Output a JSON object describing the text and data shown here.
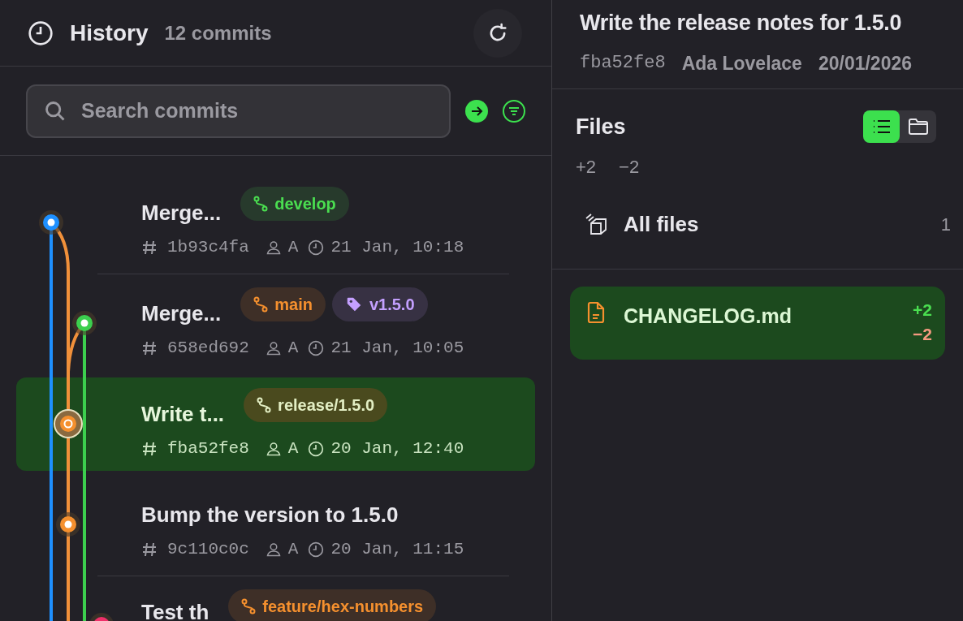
{
  "history": {
    "title": "History",
    "count": "12 commits"
  },
  "search": {
    "placeholder": "Search commits"
  },
  "commits": [
    {
      "title": "Merge...",
      "hash": "1b93c4fa",
      "author": "A",
      "time": "21 Jan, 10:18",
      "selected": false,
      "color": "#1e90ff",
      "refs": [
        {
          "kind": "branch",
          "label": "develop",
          "color": "#4ade50"
        }
      ]
    },
    {
      "title": "Merge...",
      "hash": "658ed692",
      "author": "A",
      "time": "21 Jan, 10:05",
      "selected": false,
      "color": "#3ccf4e",
      "refs": [
        {
          "kind": "branch",
          "label": "main",
          "color": "#f5902e"
        },
        {
          "kind": "tag",
          "label": "v1.5.0",
          "color": "#c4a0ff"
        }
      ]
    },
    {
      "title": "Write t...",
      "hash": "fba52fe8",
      "author": "A",
      "time": "20 Jan, 12:40",
      "selected": true,
      "color": "#f5902e",
      "refs": [
        {
          "kind": "branch",
          "label": "release/1.5.0",
          "color": "#e3efc4"
        }
      ]
    },
    {
      "title": "Bump the version to 1.5.0",
      "hash": "9c110c0c",
      "author": "A",
      "time": "20 Jan, 11:15",
      "selected": false,
      "color": "#f5902e"
    },
    {
      "title": "Test th",
      "selected": false,
      "color": "#f0306a",
      "refs": [
        {
          "kind": "branch",
          "label": "feature/hex-numbers",
          "color": "#f5902e"
        }
      ]
    }
  ],
  "detail": {
    "title": "Write the release notes for 1.5.0",
    "hash": "fba52fe8",
    "author": "Ada Lovelace",
    "date": "20/01/2026"
  },
  "files": {
    "title": "Files",
    "added": "+2",
    "removed": "−2",
    "views": [
      {
        "kind": "list",
        "selected": true
      },
      {
        "kind": "folder",
        "selected": false
      }
    ],
    "all_files": {
      "label": "All files",
      "count": "1"
    },
    "items": [
      {
        "name": "CHANGELOG.md",
        "added": "+2",
        "removed": "−2",
        "selected": true
      }
    ]
  }
}
